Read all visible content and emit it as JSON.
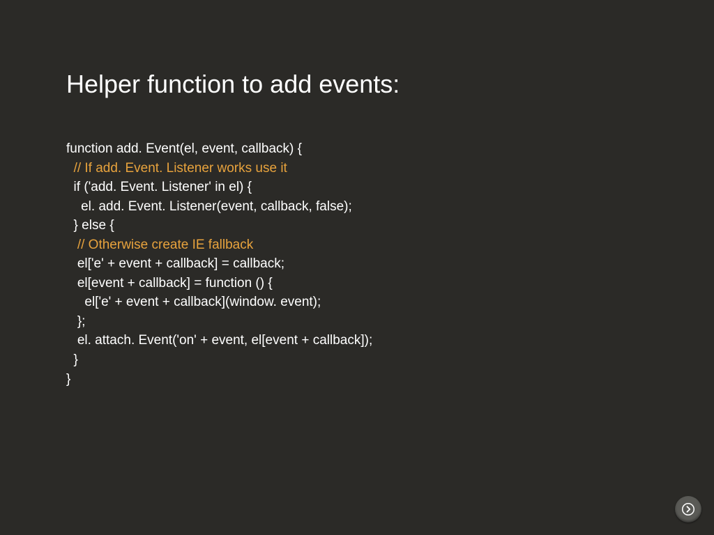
{
  "title": "Helper function to add events:",
  "code": {
    "l1": "function add. Event(el, event, callback) {",
    "l2_pre": "  ",
    "l2_comment": "// If add. Event. Listener works use it",
    "l3": "  if ('add. Event. Listener' in el) {",
    "l4": "    el. add. Event. Listener(event, callback, false);",
    "l5": "  } else {",
    "l6_pre": "   ",
    "l6_comment": "// Otherwise create IE fallback",
    "l7": "   el['e' + event + callback] = callback;",
    "l8": "   el[event + callback] = function () {",
    "l9": "     el['e' + event + callback](window. event);",
    "l10": "   };",
    "l11": "   el. attach. Event('on' + event, el[event + callback]);",
    "l12": "  }",
    "l13": "}"
  }
}
